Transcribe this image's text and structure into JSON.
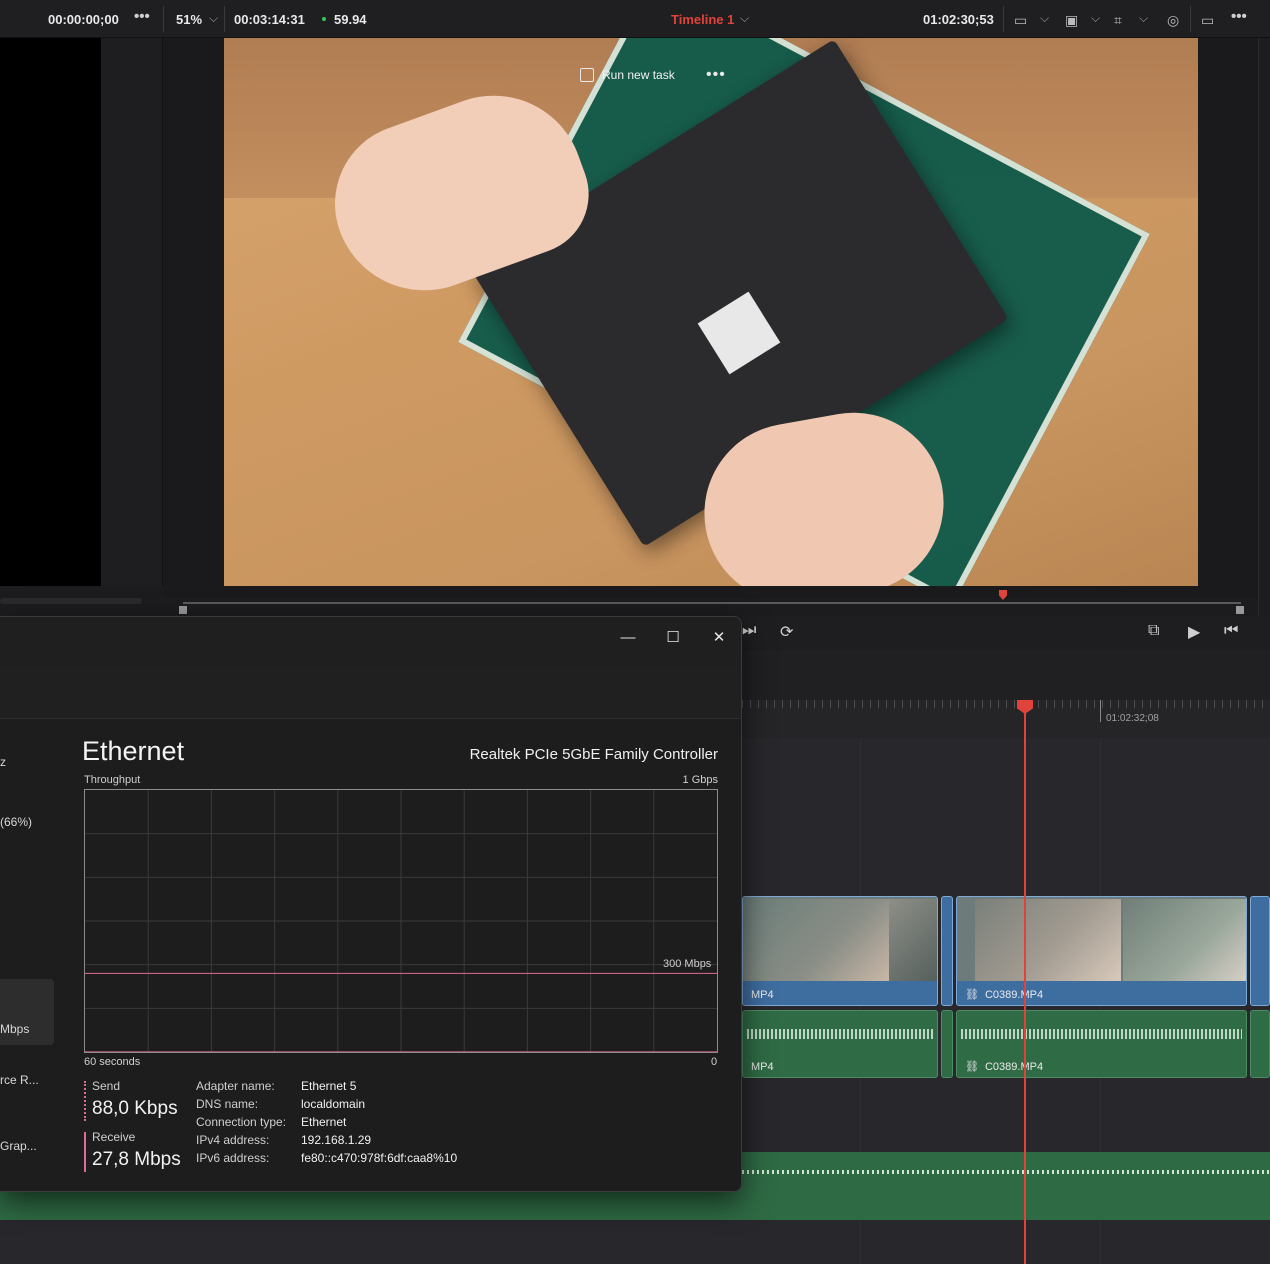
{
  "resolve": {
    "source_timecode": "00:00:00;00",
    "zoom": "51%",
    "duration": "00:03:14:31",
    "fps": "59.94",
    "timeline_name": "Timeline 1",
    "record_timecode": "01:02:30;53",
    "ruler_timecode": "01:02:32;08",
    "clips": {
      "video_left_label": "MP4",
      "video_right_label": "C0389.MP4",
      "audio_left_label": "MP4",
      "audio_right_label": "C0389.MP4"
    }
  },
  "task_manager": {
    "run_new_task": "Run new task",
    "sidebar_fragments": [
      "z",
      "(66%)",
      "Mbps",
      "rce R...",
      "Grap..."
    ],
    "title": "Ethernet",
    "adapter": "Realtek PCIe 5GbE Family Controller",
    "throughput_label": "Throughput",
    "max_label": "1 Gbps",
    "ref_line_label": "300 Mbps",
    "time_label": "60 seconds",
    "zero_label": "0",
    "send_label": "Send",
    "send_value": "88,0 Kbps",
    "receive_label": "Receive",
    "receive_value": "27,8 Mbps",
    "properties": [
      {
        "key": "Adapter name:",
        "value": "Ethernet 5"
      },
      {
        "key": "DNS name:",
        "value": "localdomain"
      },
      {
        "key": "Connection type:",
        "value": "Ethernet"
      },
      {
        "key": "IPv4 address:",
        "value": "192.168.1.29"
      },
      {
        "key": "IPv6 address:",
        "value": "fe80::c470:978f:6df:caa8%10"
      }
    ],
    "colors": {
      "receive": "#e06b9a",
      "send": "#e06b9a",
      "fill": "#4a1228"
    }
  },
  "chart_data": {
    "type": "area",
    "title": "Throughput",
    "xlabel": "60 seconds",
    "ylabel": "",
    "ylim": [
      0,
      1000
    ],
    "unit": "Mbps",
    "reference_line": 300,
    "x": [
      60,
      59,
      58,
      57,
      56,
      55,
      54,
      53,
      52,
      51,
      50,
      49,
      48,
      47,
      46,
      45,
      44,
      43,
      42,
      41,
      40,
      39,
      38,
      37,
      36,
      35,
      34,
      33,
      32,
      31,
      30,
      29,
      28,
      27,
      26,
      25,
      24,
      23,
      22,
      21,
      20,
      19,
      18,
      17,
      16,
      15,
      14,
      13,
      12,
      11,
      10,
      9,
      8,
      7,
      6,
      5,
      4,
      3,
      2,
      1,
      0
    ],
    "series": [
      {
        "name": "Receive",
        "values": [
          0,
          0,
          0,
          0,
          0,
          0,
          0,
          0,
          0,
          0,
          0,
          0,
          0,
          0,
          0,
          0,
          0,
          0,
          0,
          0,
          0,
          0,
          0,
          0,
          0,
          0,
          0,
          0,
          0,
          0,
          0,
          0,
          0,
          0,
          0,
          0,
          0,
          0,
          0,
          0,
          0,
          0,
          0,
          0,
          0,
          0,
          0,
          0,
          0,
          0,
          0,
          0,
          0,
          0,
          0,
          0,
          0,
          0,
          0,
          0,
          0
        ]
      }
    ]
  }
}
